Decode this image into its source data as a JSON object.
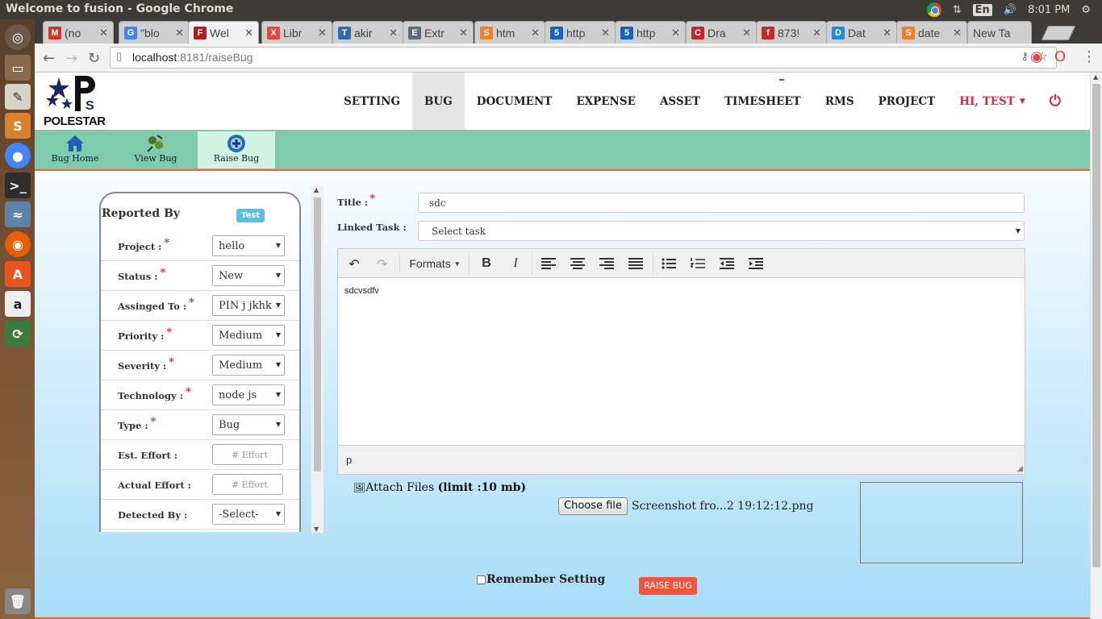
{
  "os": {
    "window_title": "Welcome to fusion - Google Chrome",
    "lang": "En",
    "clock": "8:01 PM"
  },
  "browser": {
    "tabs": [
      {
        "label": "(no",
        "icon": "gmail-icon",
        "color": "#d93025",
        "glyph": "M"
      },
      {
        "label": "\"blo",
        "icon": "google-icon",
        "color": "#4285f4",
        "glyph": "G"
      },
      {
        "label": "Wel",
        "icon": "fusion-icon",
        "color": "#b71c1c",
        "glyph": "F",
        "active": true
      },
      {
        "label": "Libr",
        "icon": "x-icon",
        "color": "#e8453c",
        "glyph": "X"
      },
      {
        "label": "akir",
        "icon": "t-icon",
        "color": "#2b6cb0",
        "glyph": "T"
      },
      {
        "label": "Extr",
        "icon": "e-icon",
        "color": "#546e7a",
        "glyph": "E"
      },
      {
        "label": "htm",
        "icon": "stackoverflow-icon",
        "color": "#f48024",
        "glyph": "S"
      },
      {
        "label": "http",
        "icon": "html5-icon",
        "color": "#1565c0",
        "glyph": "5"
      },
      {
        "label": "http",
        "icon": "html5-icon",
        "color": "#1565c0",
        "glyph": "5"
      },
      {
        "label": "Dra",
        "icon": "draw-icon",
        "color": "#c62828",
        "glyph": "C"
      },
      {
        "label": "873!",
        "icon": "f-icon",
        "color": "#c62828",
        "glyph": "f"
      },
      {
        "label": "Dat",
        "icon": "dat-icon",
        "color": "#1e88e5",
        "glyph": "D"
      },
      {
        "label": "date",
        "icon": "stackoverflow-icon",
        "color": "#f48024",
        "glyph": "S"
      },
      {
        "label": "New Ta",
        "icon": "",
        "color": "",
        "glyph": ""
      }
    ],
    "url_host": "localhost",
    "url_path": ":8181/raiseBug"
  },
  "app": {
    "logo_text": "POLESTAR",
    "nav": [
      "SETTING",
      "BUG",
      "DOCUMENT",
      "EXPENSE",
      "ASSET",
      "TIMESHEET",
      "RMS",
      "PROJECT"
    ],
    "active_nav": "BUG",
    "user_menu": "HI, TEST",
    "subnav": [
      {
        "label": "Bug Home",
        "icon": "home-icon"
      },
      {
        "label": "View Bug",
        "icon": "view-bug-icon"
      },
      {
        "label": "Raise Bug",
        "icon": "raise-bug-icon",
        "active": true
      }
    ]
  },
  "form": {
    "reported_by_label": "Reported By",
    "reported_by_value": "Test",
    "fields": [
      {
        "label": "Project :",
        "required": true,
        "type": "select",
        "value": "hello"
      },
      {
        "label": "Status :",
        "required": true,
        "type": "select",
        "value": "New"
      },
      {
        "label": "Assinged To :",
        "required": true,
        "type": "select",
        "value": "PIN j jkhk"
      },
      {
        "label": "Priority :",
        "required": true,
        "type": "select",
        "value": "Medium"
      },
      {
        "label": "Severity :",
        "required": true,
        "type": "select",
        "value": "Medium"
      },
      {
        "label": "Technology :",
        "required": true,
        "type": "select",
        "value": "node js"
      },
      {
        "label": "Type :",
        "required": true,
        "type": "select",
        "value": "Bug"
      },
      {
        "label": "Est. Effort :",
        "required": false,
        "type": "input",
        "value": "# Effort"
      },
      {
        "label": "Actual Effort :",
        "required": false,
        "type": "input",
        "value": "# Effort"
      },
      {
        "label": "Detected By :",
        "required": false,
        "type": "select",
        "value": "-Select-"
      }
    ],
    "title_label": "Title :",
    "title_value": "sdc",
    "linked_task_label": "Linked Task :",
    "linked_task_value": "Select task",
    "editor": {
      "formats_label": "Formats",
      "content": "sdcvsdfv",
      "status_path": "p"
    },
    "attach_label": "Attach Files",
    "attach_limit": "(limit :10 mb)",
    "choose_file_label": "Choose file",
    "file_name": "Screenshot fro...2 19:12:12.png",
    "remember_label": "Remember Setting",
    "submit_label": "RAISE BUG"
  }
}
